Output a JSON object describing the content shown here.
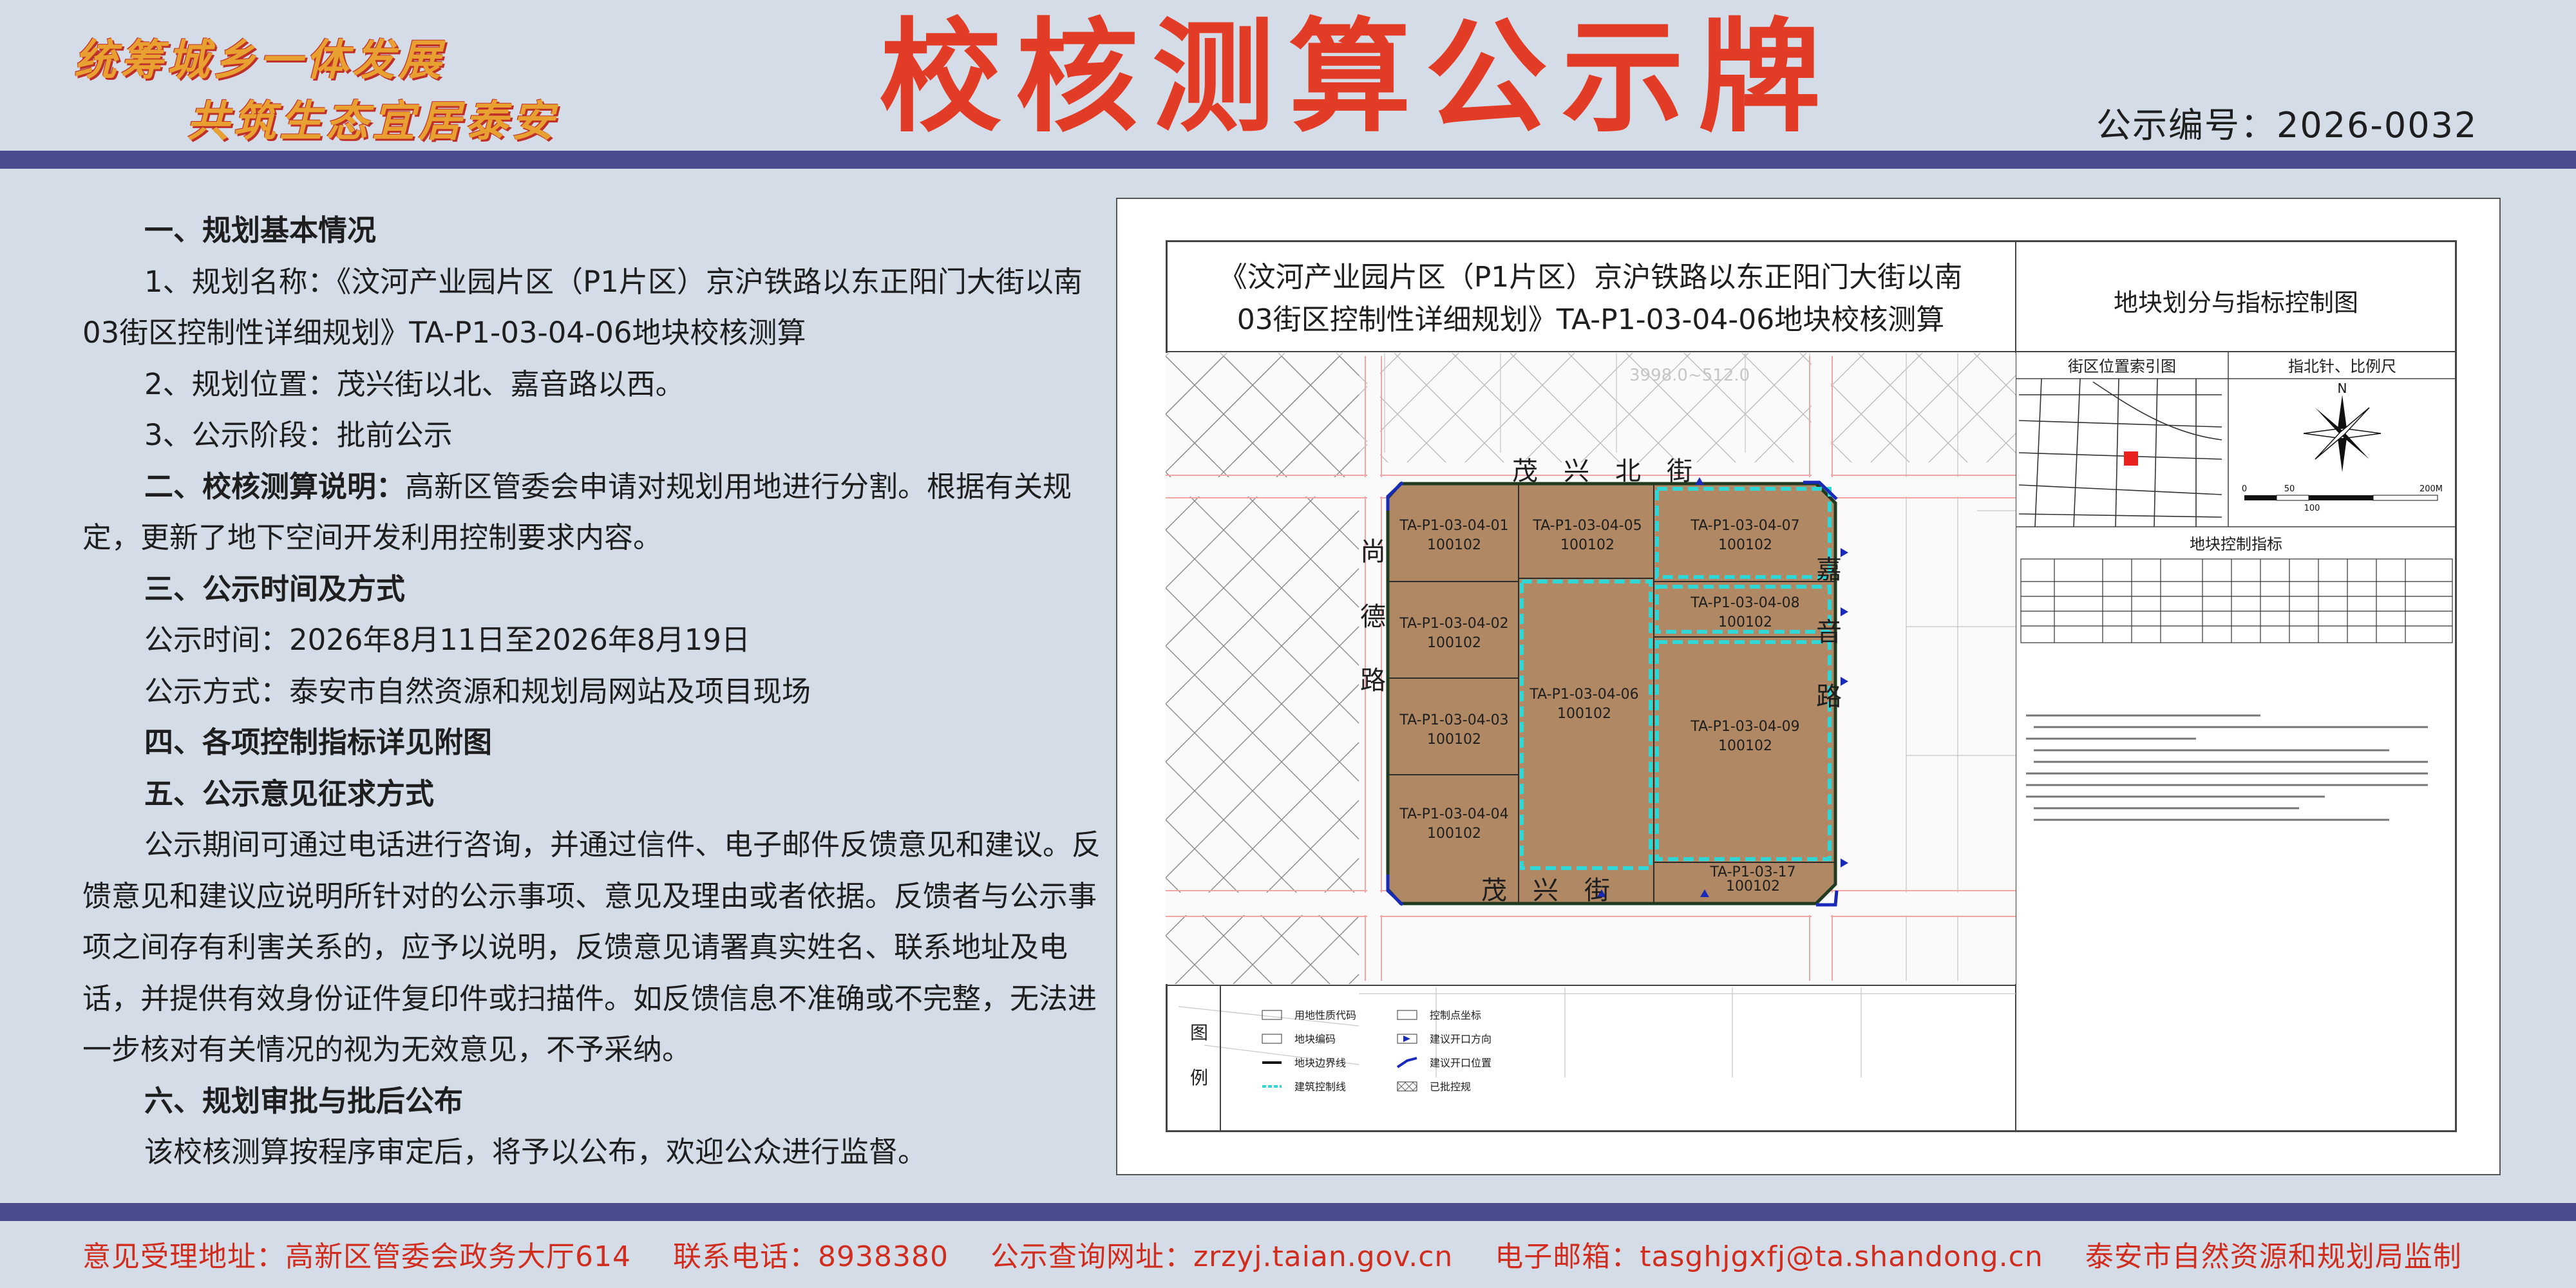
{
  "header": {
    "slogan_line1": "统筹城乡一体发展",
    "slogan_line2": "共筑生态宜居泰安",
    "title": "校核测算公示牌",
    "notice_number": "公示编号：2026-0032"
  },
  "body": {
    "h1": "一、规划基本情况",
    "item1": "1、规划名称：《汶河产业园片区（P1片区）京沪铁路以东正阳门大街以南03街区控制性详细规划》TA-P1-03-04-06地块校核测算",
    "item2": "2、规划位置：茂兴街以北、嘉音路以西。",
    "item3": "3、公示阶段：批前公示",
    "h2_label": "二、校核测算说明：",
    "h2_text": "高新区管委会申请对规划用地进行分割。根据有关规定，更新了地下空间开发利用控制要求内容。",
    "h3": "三、公示时间及方式",
    "time": "公示时间：2026年8月11日至2026年8月19日",
    "method": "公示方式：泰安市自然资源和规划局网站及项目现场",
    "h4": "四、各项控制指标详见附图",
    "h5": "五、公示意见征求方式",
    "para5": "公示期间可通过电话进行咨询，并通过信件、电子邮件反馈意见和建议。反馈意见和建议应说明所针对的公示事项、意见及理由或者依据。反馈者与公示事项之间存有利害关系的，应予以说明，反馈意见请署真实姓名、联系地址及电话，并提供有效身份证件复印件或扫描件。如反馈信息不准确或不完整，无法进一步核对有关情况的视为无效意见，不予采纳。",
    "h6": "六、规划审批与批后公布",
    "para6": "该校核测算按程序审定后，将予以公布，欢迎公众进行监督。"
  },
  "plan": {
    "title_line1": "《汶河产业园片区（P1片区）京沪铁路以东正阳门大街以南",
    "title_line2": "03街区控制性详细规划》TA-P1-03-04-06地块校核测算",
    "right_title": "地块划分与指标控制图",
    "index_map_label": "街区位置索引图",
    "compass_label": "指北针、比例尺",
    "indicator_title": "地块控制指标",
    "faint_label": "3998.0~512.0",
    "roads": {
      "north": "茂　兴　北　街",
      "south": "茂　兴　街",
      "west": [
        "尚",
        "德",
        "路"
      ],
      "east": [
        "嘉",
        "音",
        "路"
      ]
    },
    "parcels": [
      {
        "code": "TA-P1-03-04-01",
        "use": "100102"
      },
      {
        "code": "TA-P1-03-04-05",
        "use": "100102"
      },
      {
        "code": "TA-P1-03-04-07",
        "use": "100102"
      },
      {
        "code": "TA-P1-03-04-02",
        "use": "100102"
      },
      {
        "code": "TA-P1-03-04-08",
        "use": "100102"
      },
      {
        "code": "TA-P1-03-04-06",
        "use": "100102"
      },
      {
        "code": "TA-P1-03-04-03",
        "use": "100102"
      },
      {
        "code": "TA-P1-03-04-09",
        "use": "100102"
      },
      {
        "code": "TA-P1-03-04-04",
        "use": "100102"
      },
      {
        "code": "TA-P1-03-17",
        "use": "100102"
      }
    ],
    "legend_title": [
      "图",
      "例"
    ],
    "legend": [
      "用地性质代码",
      "控制点坐标",
      "地块编码",
      "建议开口方向",
      "地块边界线",
      "建议开口位置",
      "建筑控制线",
      "已批控规"
    ],
    "scale_ticks": [
      "0",
      "50",
      "100",
      "200M"
    ],
    "compass_n": "N"
  },
  "footer": {
    "address": "意见受理地址：高新区管委会政务大厅614",
    "phone": "联系电话：8938380",
    "website": "公示查询网址：zrzyj.taian.gov.cn",
    "email": "电子邮箱：tasghjgxfj@ta.shandong.cn",
    "authority": "泰安市自然资源和规划局监制"
  },
  "colors": {
    "background": "#d4dde7",
    "title_red": "#e23c26",
    "band": "#4b4c8f",
    "parcel_fill": "#b08964",
    "setback_cyan": "#2fd6d6",
    "road_blue": "#1a2ab8"
  }
}
